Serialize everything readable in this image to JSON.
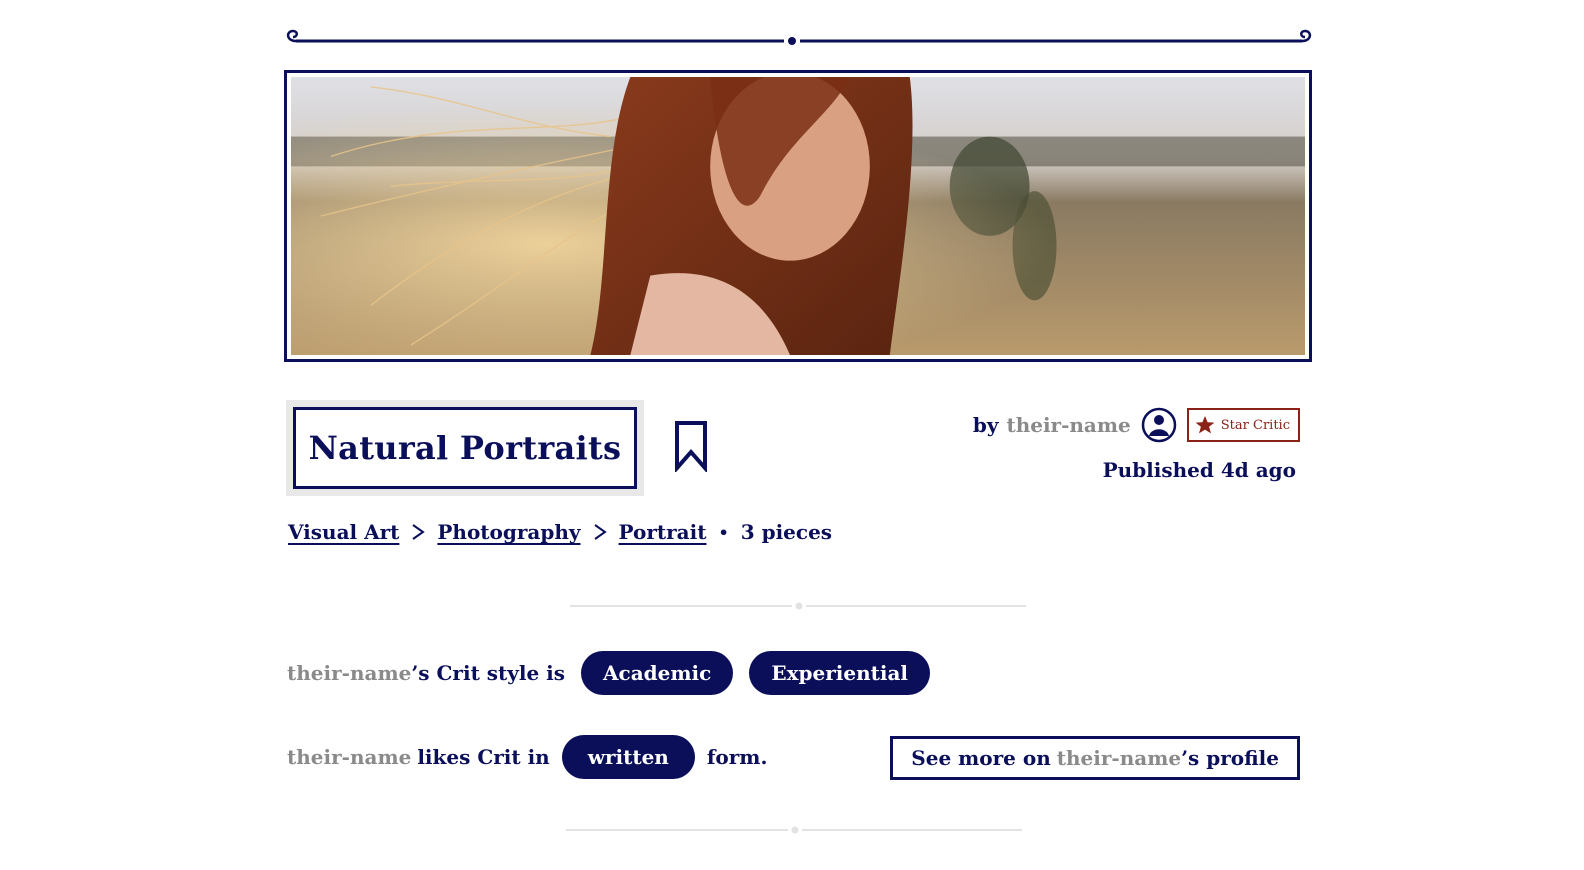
{
  "colors": {
    "navy": "#0b0f5a",
    "muted": "#8a8a8a",
    "badge_red": "#8b2217",
    "divider": "#e2e2e2"
  },
  "hero": {
    "image_desc_icon": "portrait-photo"
  },
  "collection": {
    "title": "Natural Portraits",
    "bookmark_icon": "bookmark-icon"
  },
  "author": {
    "by": "by",
    "name": "their-name",
    "avatar_icon": "user-avatar-icon",
    "badge_icon": "star-icon",
    "badge_label": "Star Critic",
    "published": "Published 4d ago"
  },
  "breadcrumb": {
    "items": [
      "Visual Art",
      "Photography",
      "Portrait"
    ],
    "count": "3 pieces"
  },
  "crit_style": {
    "name": "their-name",
    "suffix": "’s Crit style is",
    "tags": [
      "Academic",
      "Experiential"
    ]
  },
  "crit_form": {
    "name": "their-name",
    "middle": "likes Crit in",
    "form": "written",
    "end": "form."
  },
  "profile_button": {
    "prefix": "See more on",
    "name": "their-name",
    "suffix": "’s profile"
  }
}
